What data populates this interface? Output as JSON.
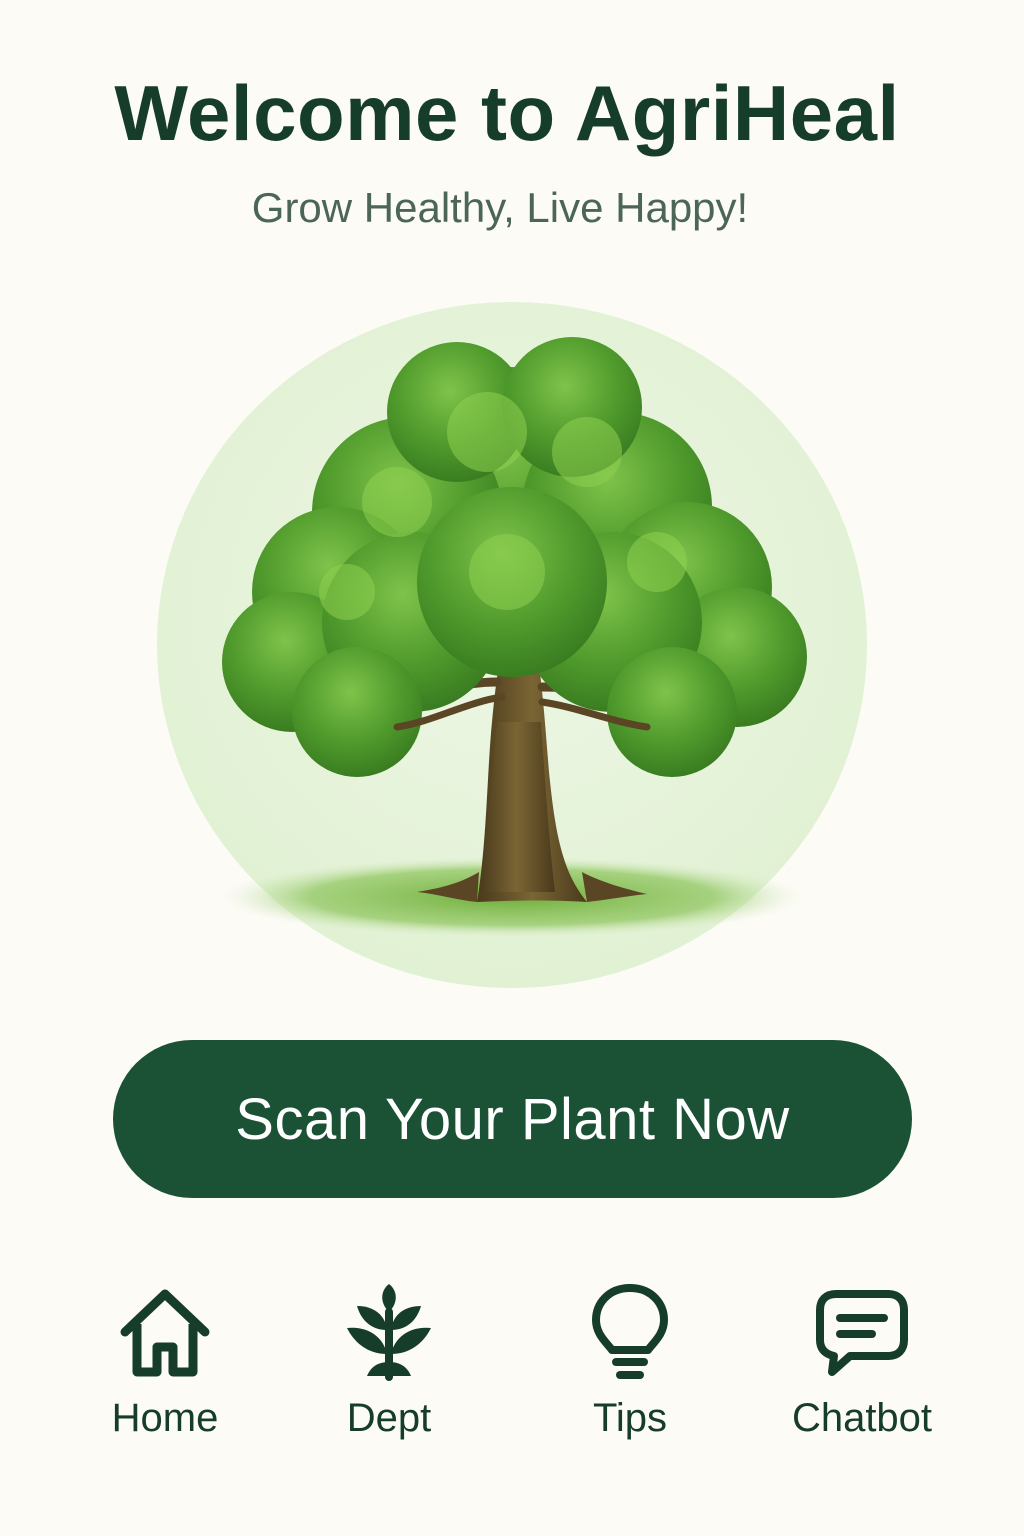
{
  "header": {
    "title": "Welcome to AgriHeal",
    "subtitle": "Grow Healthy, Live Happy!"
  },
  "hero": {
    "image": "tree-illustration",
    "background_color": "#e4f3d8"
  },
  "primary_action": {
    "label": "Scan Your Plant Now",
    "color": "#1b5235"
  },
  "bottom_nav": {
    "items": [
      {
        "label": "Home",
        "icon": "home-icon"
      },
      {
        "label": "Dept",
        "icon": "plant-icon"
      },
      {
        "label": "Tips",
        "icon": "lightbulb-icon"
      },
      {
        "label": "Chatbot",
        "icon": "chat-bubble-icon"
      }
    ]
  },
  "colors": {
    "background": "#fcfbf6",
    "primary_dark_green": "#163d2a",
    "subtitle_gray_green": "#4c6656"
  }
}
